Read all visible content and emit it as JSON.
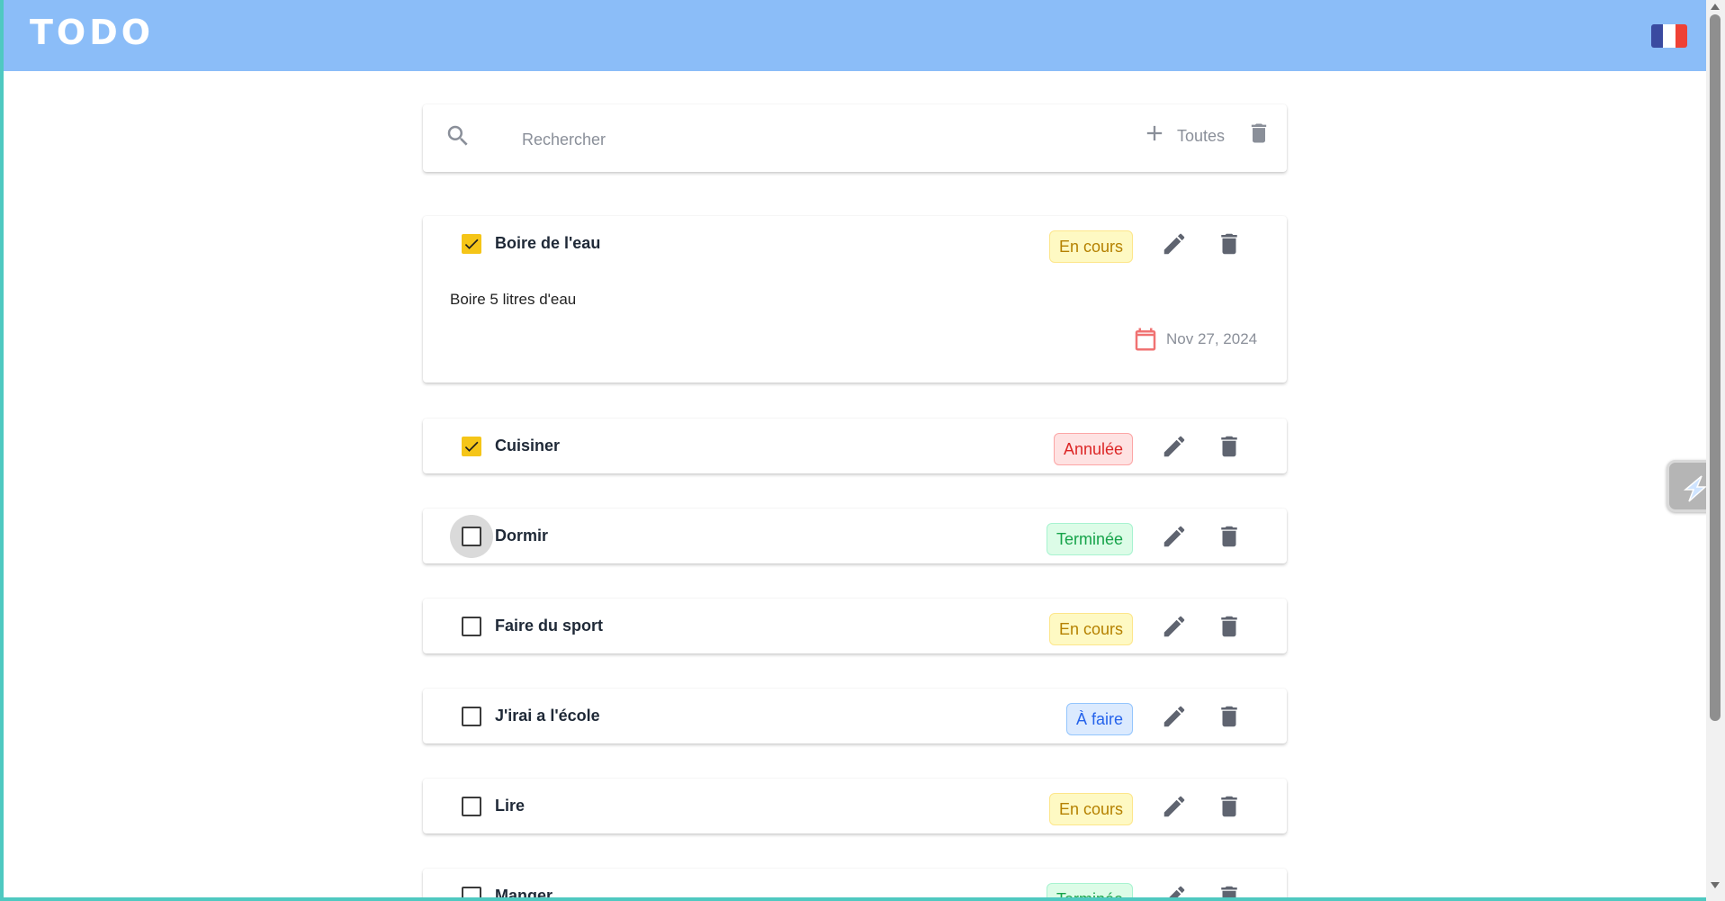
{
  "app": {
    "title": "TODO"
  },
  "language": {
    "flag_icon": "french-flag-icon",
    "colors": [
      "#3a4aa0",
      "#ffffff",
      "#ef4135"
    ]
  },
  "toolbar": {
    "search_placeholder": "Rechercher",
    "search_value": "",
    "search_icon": "search-icon",
    "add_icon": "plus-icon",
    "filter_label": "Toutes",
    "clear_icon": "trash-icon"
  },
  "status_colors": {
    "En cours": "#b58100",
    "Annulée": "#dc2626",
    "Terminée": "#16a34a",
    "À faire": "#2563eb"
  },
  "todos": [
    {
      "title": "Boire de l'eau",
      "checked": true,
      "status": "En cours",
      "status_kind": "progress",
      "description": "Boire 5 litres d'eau",
      "date": "Nov 27, 2024"
    },
    {
      "title": "Cuisiner",
      "checked": true,
      "status": "Annulée",
      "status_kind": "cancelled"
    },
    {
      "title": "Dormir",
      "checked": false,
      "status": "Terminée",
      "status_kind": "done"
    },
    {
      "title": "Faire du sport",
      "checked": false,
      "status": "En cours",
      "status_kind": "progress"
    },
    {
      "title": "J'irai a l'école",
      "checked": false,
      "status": "À faire",
      "status_kind": "todo"
    },
    {
      "title": "Lire",
      "checked": false,
      "status": "En cours",
      "status_kind": "progress"
    },
    {
      "title": "Manger",
      "checked": false,
      "status": "Terminée",
      "status_kind": "done"
    }
  ],
  "side_widget": {
    "icon": "extension-lightning-icon"
  }
}
